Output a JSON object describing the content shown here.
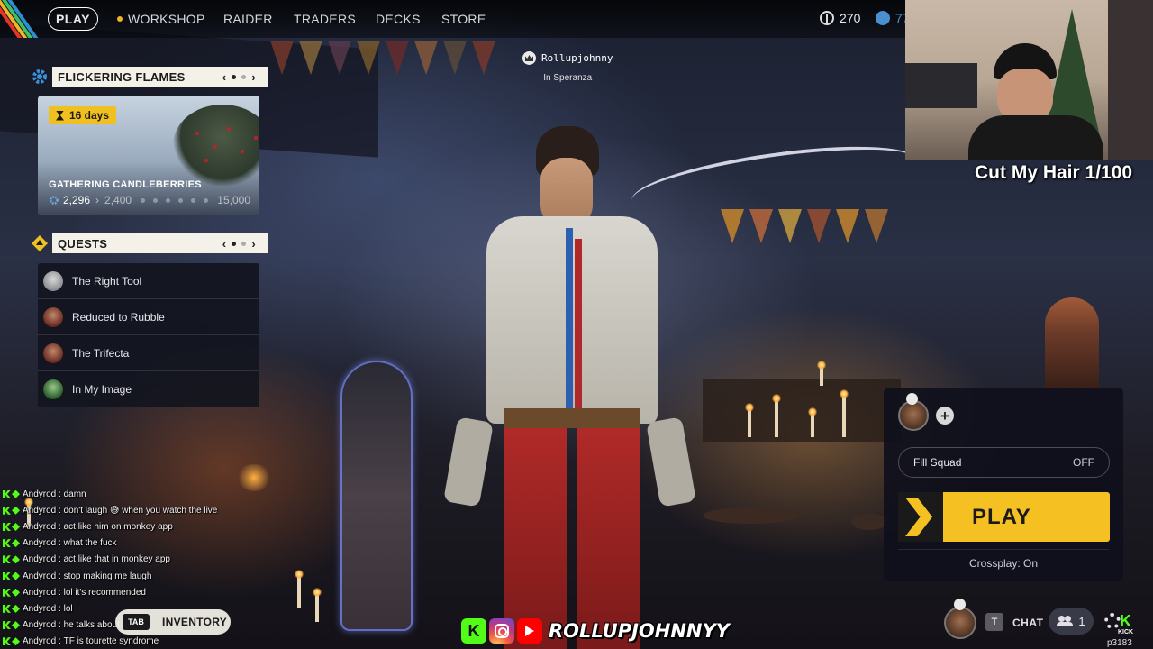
{
  "nav": {
    "play": "PLAY",
    "items": [
      "WORKSHOP",
      "RAIDER",
      "TRADERS",
      "DECKS",
      "STORE"
    ],
    "currency_1": "270",
    "currency_2": "77"
  },
  "event": {
    "title": "FLICKERING FLAMES",
    "days_left": "16 days",
    "card_title": "GATHERING CANDLEBERRIES",
    "current": "2,296",
    "next_milestone": "2,400",
    "max": "15,000"
  },
  "quests": {
    "title": "QUESTS",
    "items": [
      {
        "name": "The Right Tool",
        "avatar_color": "#9aa0a6"
      },
      {
        "name": "Reduced to Rubble",
        "avatar_color": "#8a4a3a"
      },
      {
        "name": "The Trifecta",
        "avatar_color": "#8a4a3a"
      },
      {
        "name": "In My Image",
        "avatar_color": "#4a7a4a"
      }
    ]
  },
  "player": {
    "name": "Rollupjohnny",
    "location": "In Speranza"
  },
  "stream": {
    "overlay_title": "Cut My Hair 1/100",
    "handle": "ROLLUPJOHNNYY"
  },
  "lobby": {
    "add_icon": "+",
    "fill_squad_label": "Fill Squad",
    "fill_squad_value": "OFF",
    "play_label": "PLAY",
    "crossplay": "Crossplay: On"
  },
  "chat": [
    {
      "user": "Andyrod",
      "msg": "damn"
    },
    {
      "user": "Andyrod",
      "msg": "don't laugh 😅 when you watch the live"
    },
    {
      "user": "Andyrod",
      "msg": "act like him on monkey app"
    },
    {
      "user": "Andyrod",
      "msg": "what the fuck"
    },
    {
      "user": "Andyrod",
      "msg": "act like that in monkey app"
    },
    {
      "user": "Andyrod",
      "msg": "stop making me laugh"
    },
    {
      "user": "Andyrod",
      "msg": "lol it's recommended"
    },
    {
      "user": "Andyrod",
      "msg": "lol"
    },
    {
      "user": "Andyrod",
      "msg": "he talks about sports"
    },
    {
      "user": "Andyrod",
      "msg": "TF is tourette syndrome"
    }
  ],
  "bottom": {
    "tab_key": "TAB",
    "inventory": "INVENTORY",
    "t_key": "T",
    "chat": "CHAT",
    "friends_count": "1",
    "kick_glyph": "K",
    "kick_label": "KICK",
    "build_id": "p3183"
  },
  "colors": {
    "accent_yellow": "#f5c022",
    "kick_green": "#53fc18",
    "panel_cream": "#f4f1e8"
  }
}
